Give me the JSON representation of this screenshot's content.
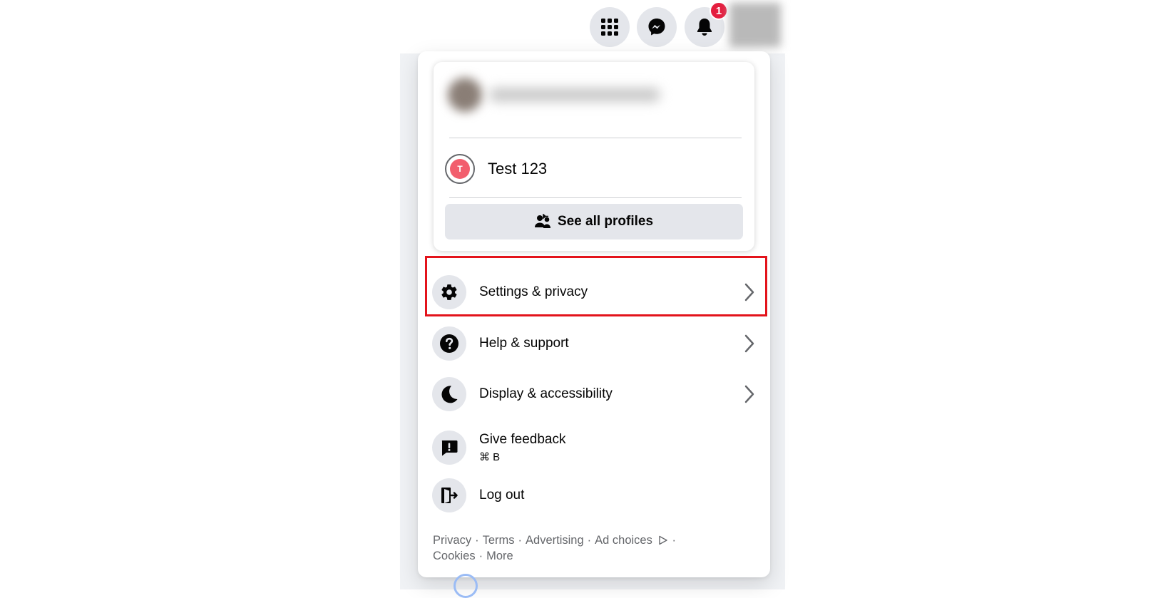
{
  "topbar": {
    "icons": [
      "apps-grid-icon",
      "messenger-icon",
      "bell-icon"
    ],
    "notification_count": "1"
  },
  "profile": {
    "switch_profile_name": "Test 123",
    "switch_avatar_initial": "T",
    "see_all_label": "See all profiles"
  },
  "menu": {
    "items": [
      {
        "label": "Settings & privacy",
        "icon": "gear-icon",
        "has_chevron": true,
        "highlighted": true
      },
      {
        "label": "Help & support",
        "icon": "help-icon",
        "has_chevron": true
      },
      {
        "label": "Display & accessibility",
        "icon": "moon-icon",
        "has_chevron": true
      },
      {
        "label": "Give feedback",
        "sub": "⌘ B",
        "icon": "feedback-icon",
        "has_chevron": false
      },
      {
        "label": "Log out",
        "icon": "logout-icon",
        "has_chevron": false
      }
    ]
  },
  "footer": {
    "links": [
      "Privacy",
      "Terms",
      "Advertising",
      "Ad choices",
      "Cookies",
      "More"
    ]
  },
  "colors": {
    "highlight_border": "#e3131b",
    "badge": "#e41e3f",
    "icon_bg": "#e4e6eb",
    "secondary_text": "#65676b"
  }
}
